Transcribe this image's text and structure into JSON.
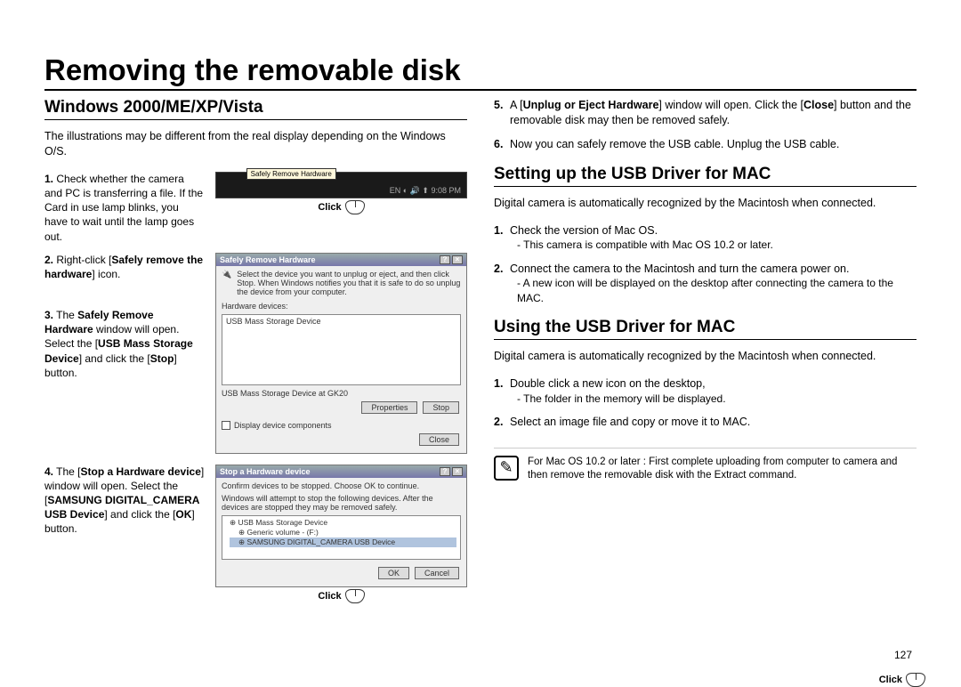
{
  "page_title": "Removing the removable disk",
  "page_number": "127",
  "left": {
    "heading": "Windows 2000/ME/XP/Vista",
    "intro": "The illustrations may be different from the real display depending on the Windows O/S.",
    "steps": [
      {
        "num": "1.",
        "text_parts": [
          "Check whether the camera and PC is transferring a file. If the Card in use lamp blinks, you have to wait until the lamp goes out."
        ],
        "click": "Click",
        "tooltip": "Safely Remove Hardware",
        "tray_time": "9:08 PM"
      },
      {
        "num": "2.",
        "pre": "Right-click [",
        "bold": "Safely remove the hardware",
        "post": "] icon.",
        "dialog_title": "Safely Remove Hardware",
        "dlg_instr": "Select the device you want to unplug or eject, and then click Stop. When Windows notifies you that it is safe to do so unplug the device from your computer.",
        "dlg_label": "Hardware devices:",
        "dlg_list_item": "USB Mass Storage Device",
        "dlg_footer": "USB Mass Storage Device at GK20",
        "btn_prop": "Properties",
        "btn_stop": "Stop",
        "chk_label": "Display device components",
        "btn_close": "Close"
      },
      {
        "num": "3.",
        "pre": "The ",
        "bold": "Safely Remove Hardware",
        "mid1": " window will open. Select the [",
        "bold2": "USB Mass Storage Device",
        "mid2": "] and click the [",
        "bold3": "Stop",
        "post": "] button.",
        "click": "Click"
      },
      {
        "num": "4.",
        "pre": "The [",
        "bold": "Stop a Hardware device",
        "mid1": "] window will open. Select the [",
        "bold2": "SAMSUNG DIGITAL_CAMERA USB Device",
        "mid2": "] and click the [",
        "bold3": "OK",
        "post": "] button.",
        "dialog_title": "Stop a Hardware device",
        "dlg_instr1": "Confirm devices to be stopped. Choose OK to continue.",
        "dlg_instr2": "Windows will attempt to stop the following devices. After the devices are stopped they may be removed safely.",
        "tree": [
          "USB Mass Storage Device",
          "Generic volume - (F:)",
          "SAMSUNG DIGITAL_CAMERA USB Device"
        ],
        "btn_ok": "OK",
        "btn_cancel": "Cancel",
        "click": "Click"
      }
    ]
  },
  "right": {
    "cont_steps": [
      {
        "num": "5.",
        "pre": "A [",
        "bold": "Unplug or Eject Hardware",
        "mid": "] window will open. Click the [",
        "bold2": "Close",
        "post": "] button and the removable disk may then be removed safely."
      },
      {
        "num": "6.",
        "text": "Now you can safely remove the USB cable. Unplug the USB cable."
      }
    ],
    "mac_setup": {
      "heading": "Setting up the USB Driver for MAC",
      "intro": "Digital camera is automatically recognized by the Macintosh when connected.",
      "items": [
        {
          "num": "1.",
          "text": "Check the version of Mac OS.",
          "sub": "- This camera is compatible with Mac OS 10.2 or later."
        },
        {
          "num": "2.",
          "text": "Connect the camera to the Macintosh and turn the camera power on.",
          "sub": "- A new icon will be displayed on the desktop after connecting the camera to the MAC."
        }
      ]
    },
    "mac_use": {
      "heading": "Using the USB Driver for MAC",
      "intro": "Digital camera is automatically recognized by the Macintosh when connected.",
      "items": [
        {
          "num": "1.",
          "text": "Double click a new icon on the desktop,",
          "sub": "- The folder in the memory will be displayed."
        },
        {
          "num": "2.",
          "text": "Select an image file and copy or move it to MAC."
        }
      ]
    },
    "note": "For Mac OS 10.2 or later : First complete uploading from computer to camera and then remove the removable disk with the Extract command."
  }
}
